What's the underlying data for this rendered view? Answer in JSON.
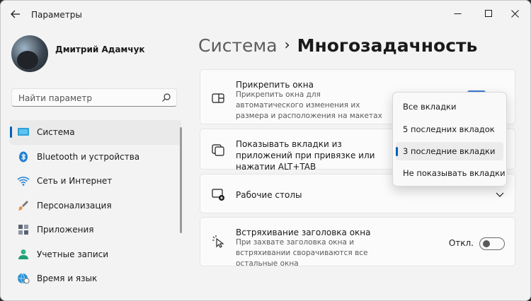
{
  "window": {
    "title": "Параметры"
  },
  "profile": {
    "name": "Дмитрий Адамчук"
  },
  "search": {
    "placeholder": "Найти параметр"
  },
  "nav": {
    "items": [
      {
        "label": "Система",
        "icon": "monitor-icon",
        "active": true
      },
      {
        "label": "Bluetooth и устройства",
        "icon": "bluetooth-icon"
      },
      {
        "label": "Сеть и Интернет",
        "icon": "wifi-icon"
      },
      {
        "label": "Персонализация",
        "icon": "brush-icon"
      },
      {
        "label": "Приложения",
        "icon": "apps-icon"
      },
      {
        "label": "Учетные записи",
        "icon": "user-icon"
      },
      {
        "label": "Время и язык",
        "icon": "globe-clock-icon"
      }
    ]
  },
  "breadcrumb": {
    "parent": "Система",
    "separator": "›",
    "current": "Многозадачность"
  },
  "settings": {
    "snap": {
      "title": "Прикрепить окна",
      "description": "Прикрепить окна для автоматического изменения их размера и расположения на макетах"
    },
    "tabs": {
      "title": "Показывать вкладки из приложений при привязке или нажатии ALT+TAB"
    },
    "desktops": {
      "title": "Рабочие столы"
    },
    "shake": {
      "title": "Встряхивание заголовка окна",
      "description": "При захвате заголовка окна и встряхивании сворачиваются все остальные окна",
      "state_label": "Откл.",
      "enabled": false
    }
  },
  "dropdown": {
    "options": [
      "Все вкладки",
      "5 последних вкладок",
      "3 последние вкладки",
      "Не показывать вкладки"
    ],
    "selected_index": 2
  },
  "colors": {
    "accent": "#005fb8",
    "background": "#f3f3f3",
    "card": "#fbfbfb"
  }
}
